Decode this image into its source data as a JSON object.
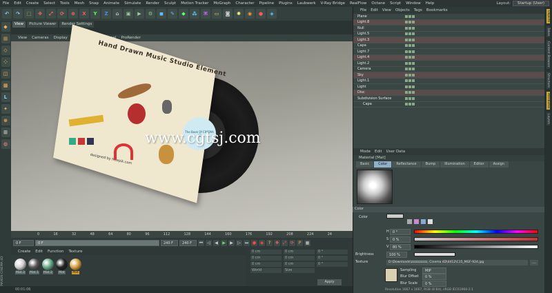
{
  "menu": [
    "File",
    "Edit",
    "Create",
    "Select",
    "Tools",
    "Mesh",
    "Snap",
    "Animate",
    "Simulate",
    "Render",
    "Sculpt",
    "Motion Tracker",
    "MoGraph",
    "Character",
    "Pipeline",
    "Plugins",
    "Laubwerk",
    "V-Ray Bridge",
    "RealFlow",
    "Octane",
    "Script",
    "Window",
    "Help"
  ],
  "layout": {
    "label": "Layout:",
    "value": "Startup (User)"
  },
  "viewport_tabs": [
    "View",
    "Picture Viewer",
    "Render Settings"
  ],
  "viewport_menu": [
    "View",
    "Cameras",
    "Display",
    "Options",
    "Filter",
    "Panel",
    "ProRender"
  ],
  "scene": {
    "sleeve_title": "Hand Drawn Music Studio Element",
    "record_label": "The Book Of CINEMA 4D",
    "designed_by": "designed by freepik.com",
    "watermark": "www.cgtsj.com"
  },
  "timeline": {
    "ticks": [
      "0",
      "16",
      "32",
      "48",
      "64",
      "80",
      "96",
      "112",
      "128",
      "144",
      "160",
      "176",
      "192",
      "208",
      "224",
      "24"
    ],
    "start": "0 F",
    "current": "0 F",
    "end": "240 F",
    "end2": "240 F"
  },
  "material_menu": [
    "Create",
    "Edit",
    "Function",
    "Texture"
  ],
  "materials": [
    {
      "name": "Mat.3",
      "color": "#d0d0d0"
    },
    {
      "name": "Mat.1",
      "color": "#555"
    },
    {
      "name": "Mat.2",
      "color": "#6a8"
    },
    {
      "name": "Mat",
      "color": "#222"
    },
    {
      "name": "Mat",
      "color": "#d8a040"
    }
  ],
  "coords": {
    "labels": [
      "X",
      "Y",
      "Z",
      "X",
      "Y",
      "Z",
      "X",
      "Y",
      "Z"
    ],
    "values": [
      "0 cm",
      "0 cm",
      "0 cm",
      "0 cm",
      "0 cm",
      "0 cm",
      "0 °",
      "0 °",
      "0 °"
    ],
    "mode1": "World",
    "mode2": "Size",
    "apply": "Apply"
  },
  "status": "00:01:06",
  "object_menu": [
    "File",
    "Edit",
    "View",
    "Objects",
    "Tags",
    "Bookmarks"
  ],
  "objects": [
    "Plane",
    "Light.8",
    "Null",
    "Light.5",
    "Light.3",
    "Capa",
    "Light.7",
    "Light.4",
    "Light.2",
    "Camera",
    "Sky",
    "Light.1",
    "Light",
    "Disc",
    "Subdivision Surface",
    "Capa"
  ],
  "attr_menu": [
    "Mode",
    "Edit",
    "User Data"
  ],
  "material_name": "Material [Mat]",
  "attr_tabs": [
    "Basic",
    "Color",
    "Reflectance",
    "Bump",
    "Illumination",
    "Editor",
    "Assign"
  ],
  "color_section": "Color",
  "color": {
    "label": "Color",
    "h": "0 °",
    "s": "0 %",
    "v": "80 %"
  },
  "brightness": {
    "label": "Brightness",
    "value": "100 %"
  },
  "texture": {
    "label": "Texture",
    "path": "D:\\Downloads\\zzzzzzzzzz, Cinema 4D\\4412\\C15_MGF-924.jpg",
    "sampling_label": "Sampling",
    "sampling": "MIP",
    "blur_offset_label": "Blur Offset",
    "blur_offset": "0 %",
    "blur_scale_label": "Blur Scale",
    "blur_scale": "0 %",
    "resolution": "Resolution 1667 x 1667, RGB (8 Bit), sRGB IEC61966-2.1"
  },
  "right_tabs": [
    "Objects",
    "Takes",
    "Content Browser",
    "Structure",
    "Attributes",
    "Layers"
  ],
  "side_logo": "MAXON CINEMA 4D"
}
